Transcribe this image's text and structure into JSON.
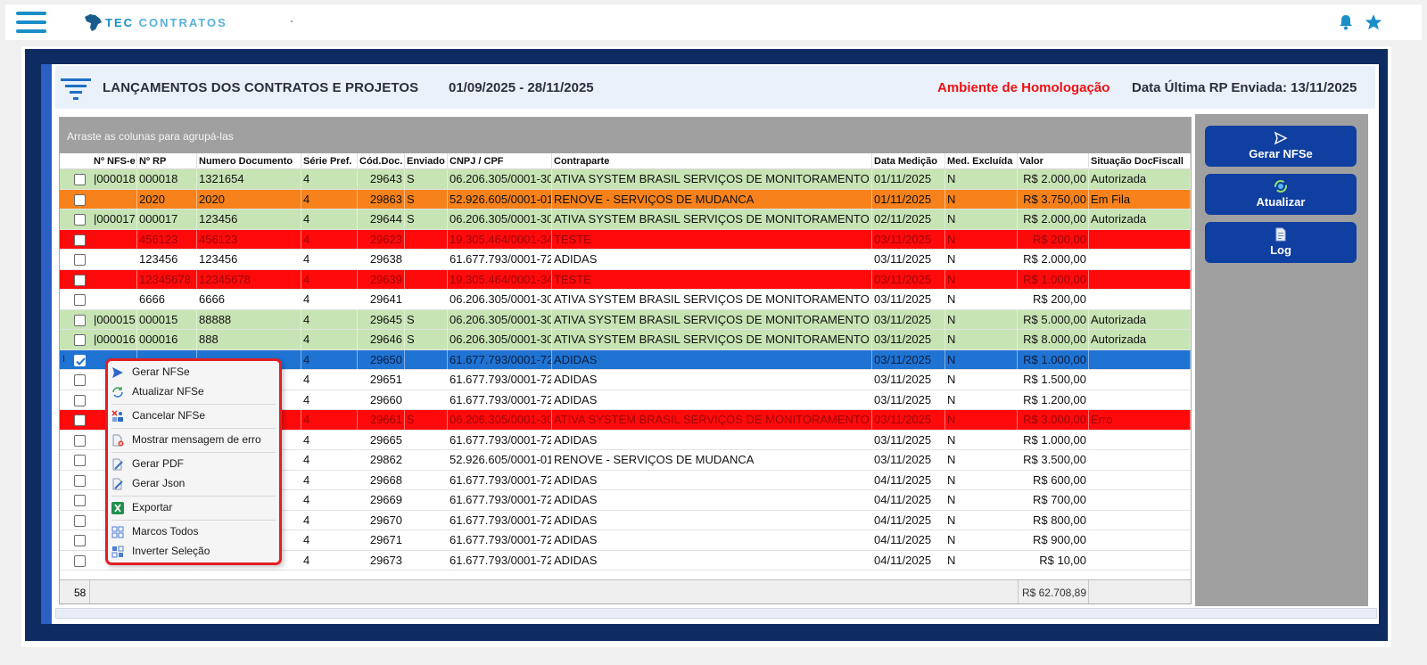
{
  "app": {
    "brand_part1": "TEC",
    "brand_part2": "CONTRATOS"
  },
  "header": {
    "title": "LANÇAMENTOS DOS CONTRATOS E PROJETOS",
    "period": "01/09/2025 - 28/11/2025",
    "environment": "Ambiente de Homologação",
    "last_rp": "Data Última RP Enviada: 13/11/2025",
    "environment_color": "#ee1111"
  },
  "grid": {
    "group_hint": "Arraste as colunas para agrupá-las",
    "columns": [
      "Nº NFS-e",
      "Nº RP",
      "Numero Documento",
      "Série Pref.",
      "Cód.Doc.",
      "Enviado",
      "CNPJ / CPF",
      "Contraparte",
      "Data Medição",
      "Med. Excluída",
      "Valor",
      "Situação DocFiscall"
    ],
    "rows": [
      {
        "style": "green",
        "checked": false,
        "nfse": "|000018",
        "rp": "000018",
        "doc": "1321654",
        "serie": "4",
        "cod": "29643",
        "env": "S",
        "cnpj": "06.206.305/0001-30",
        "contra": "ATIVA SYSTEM BRASIL SERVIÇOS DE MONITORAMENTO LTDA",
        "data": "01/11/2025",
        "excl": "N",
        "valor": "R$ 2.000,00",
        "sit": "Autorizada"
      },
      {
        "style": "orange",
        "checked": false,
        "nfse": "",
        "rp": "2020",
        "doc": "2020",
        "serie": "4",
        "cod": "29863",
        "env": "S",
        "cnpj": "52.926.605/0001-01",
        "contra": "RENOVE - SERVIÇOS DE MUDANCA",
        "data": "01/11/2025",
        "excl": "N",
        "valor": "R$ 3.750,00",
        "sit": "Em Fila"
      },
      {
        "style": "green",
        "checked": false,
        "nfse": "|000017",
        "rp": "000017",
        "doc": "123456",
        "serie": "4",
        "cod": "29644",
        "env": "S",
        "cnpj": "06.206.305/0001-30",
        "contra": "ATIVA SYSTEM BRASIL SERVIÇOS DE MONITORAMENTO LTDA",
        "data": "02/11/2025",
        "excl": "N",
        "valor": "R$ 2.000,00",
        "sit": "Autorizada"
      },
      {
        "style": "red",
        "checked": false,
        "nfse": "",
        "rp": "456123",
        "doc": "456123",
        "serie": "4",
        "cod": "29623",
        "env": "",
        "cnpj": "19.305.464/0001-34",
        "contra": "TESTE",
        "data": "03/11/2025",
        "excl": "N",
        "valor": "R$ 200,00",
        "sit": ""
      },
      {
        "style": "white",
        "checked": false,
        "nfse": "",
        "rp": "123456",
        "doc": "123456",
        "serie": "4",
        "cod": "29638",
        "env": "",
        "cnpj": "61.677.793/0001-72",
        "contra": "ADIDAS",
        "data": "03/11/2025",
        "excl": "N",
        "valor": "R$ 2.000,00",
        "sit": ""
      },
      {
        "style": "red",
        "checked": false,
        "nfse": "",
        "rp": "12345678",
        "doc": "12345678",
        "serie": "4",
        "cod": "29639",
        "env": "",
        "cnpj": "19.305.464/0001-34",
        "contra": "TESTE",
        "data": "03/11/2025",
        "excl": "N",
        "valor": "R$ 1.000,00",
        "sit": ""
      },
      {
        "style": "white",
        "checked": false,
        "nfse": "",
        "rp": "6666",
        "doc": "6666",
        "serie": "4",
        "cod": "29641",
        "env": "",
        "cnpj": "06.206.305/0001-30",
        "contra": "ATIVA SYSTEM BRASIL SERVIÇOS DE MONITORAMENTO LTDA",
        "data": "03/11/2025",
        "excl": "N",
        "valor": "R$ 200,00",
        "sit": ""
      },
      {
        "style": "green",
        "checked": false,
        "nfse": "|000015",
        "rp": "000015",
        "doc": "88888",
        "serie": "4",
        "cod": "29645",
        "env": "S",
        "cnpj": "06.206.305/0001-30",
        "contra": "ATIVA SYSTEM BRASIL SERVIÇOS DE MONITORAMENTO LTDA",
        "data": "03/11/2025",
        "excl": "N",
        "valor": "R$ 5.000,00",
        "sit": "Autorizada"
      },
      {
        "style": "green",
        "checked": false,
        "nfse": "|000016",
        "rp": "000016",
        "doc": "888",
        "serie": "4",
        "cod": "29646",
        "env": "S",
        "cnpj": "06.206.305/0001-30",
        "contra": "ATIVA SYSTEM BRASIL SERVIÇOS DE MONITORAMENTO LTDA",
        "data": "03/11/2025",
        "excl": "N",
        "valor": "R$ 8.000,00",
        "sit": "Autorizada"
      },
      {
        "style": "blue",
        "checked": true,
        "nfse": "",
        "rp": "",
        "doc": "",
        "serie": "4",
        "cod": "29650",
        "env": "",
        "cnpj": "61.677.793/0001-72",
        "contra": "ADIDAS",
        "data": "03/11/2025",
        "excl": "N",
        "valor": "R$ 1.000,00",
        "sit": ""
      },
      {
        "style": "white",
        "checked": false,
        "nfse": "",
        "rp": "",
        "doc": "",
        "serie": "4",
        "cod": "29651",
        "env": "",
        "cnpj": "61.677.793/0001-72",
        "contra": "ADIDAS",
        "data": "03/11/2025",
        "excl": "N",
        "valor": "R$ 1.500,00",
        "sit": ""
      },
      {
        "style": "white",
        "checked": false,
        "nfse": "",
        "rp": "",
        "doc": "",
        "serie": "4",
        "cod": "29660",
        "env": "",
        "cnpj": "61.677.793/0001-72",
        "contra": "ADIDAS",
        "data": "03/11/2025",
        "excl": "N",
        "valor": "R$ 1.200,00",
        "sit": ""
      },
      {
        "style": "red",
        "checked": false,
        "nfse": "",
        "rp": "",
        "doc": "",
        "serie": "4",
        "cod": "29661",
        "env": "S",
        "cnpj": "06.206.305/0001-30",
        "contra": "ATIVA SYSTEM BRASIL SERVIÇOS DE MONITORAMENTO LTDA",
        "data": "03/11/2025",
        "excl": "N",
        "valor": "R$ 3.000,00",
        "sit": "Erro"
      },
      {
        "style": "white",
        "checked": false,
        "nfse": "",
        "rp": "",
        "doc": "",
        "serie": "4",
        "cod": "29665",
        "env": "",
        "cnpj": "61.677.793/0001-72",
        "contra": "ADIDAS",
        "data": "03/11/2025",
        "excl": "N",
        "valor": "R$ 1.000,00",
        "sit": ""
      },
      {
        "style": "white",
        "checked": false,
        "nfse": "",
        "rp": "",
        "doc": "",
        "serie": "4",
        "cod": "29862",
        "env": "",
        "cnpj": "52.926.605/0001-01",
        "contra": "RENOVE - SERVIÇOS DE MUDANCA",
        "data": "03/11/2025",
        "excl": "N",
        "valor": "R$ 3.500,00",
        "sit": ""
      },
      {
        "style": "white",
        "checked": false,
        "nfse": "",
        "rp": "",
        "doc": "",
        "serie": "4",
        "cod": "29668",
        "env": "",
        "cnpj": "61.677.793/0001-72",
        "contra": "ADIDAS",
        "data": "04/11/2025",
        "excl": "N",
        "valor": "R$ 600,00",
        "sit": ""
      },
      {
        "style": "white",
        "checked": false,
        "nfse": "",
        "rp": "",
        "doc": "",
        "serie": "4",
        "cod": "29669",
        "env": "",
        "cnpj": "61.677.793/0001-72",
        "contra": "ADIDAS",
        "data": "04/11/2025",
        "excl": "N",
        "valor": "R$ 700,00",
        "sit": ""
      },
      {
        "style": "white",
        "checked": false,
        "nfse": "",
        "rp": "",
        "doc": "",
        "serie": "4",
        "cod": "29670",
        "env": "",
        "cnpj": "61.677.793/0001-72",
        "contra": "ADIDAS",
        "data": "04/11/2025",
        "excl": "N",
        "valor": "R$ 800,00",
        "sit": ""
      },
      {
        "style": "white",
        "checked": false,
        "nfse": "",
        "rp": "",
        "doc": "",
        "serie": "4",
        "cod": "29671",
        "env": "",
        "cnpj": "61.677.793/0001-72",
        "contra": "ADIDAS",
        "data": "04/11/2025",
        "excl": "N",
        "valor": "R$ 900,00",
        "sit": ""
      },
      {
        "style": "white",
        "checked": false,
        "nfse": "",
        "rp": "",
        "doc": "",
        "serie": "4",
        "cod": "29673",
        "env": "",
        "cnpj": "61.677.793/0001-72",
        "contra": "ADIDAS",
        "data": "04/11/2025",
        "excl": "N",
        "valor": "R$ 10,00",
        "sit": ""
      }
    ],
    "footer_count": "58",
    "footer_total": "R$ 62.708,89"
  },
  "side_buttons": [
    {
      "label": "Gerar NFSe",
      "icon": "send-icon"
    },
    {
      "label": "Atualizar",
      "icon": "refresh-icon"
    },
    {
      "label": "Log",
      "icon": "document-icon"
    }
  ],
  "context_menu": {
    "items": [
      {
        "label": "Gerar NFSe",
        "icon": "send-icon"
      },
      {
        "label": "Atualizar NFSe",
        "icon": "refresh-icon"
      },
      {
        "label": "Cancelar NFSe",
        "icon": "cancel-icon"
      },
      {
        "label": "Mostrar mensagem de erro",
        "icon": "error-document-icon"
      },
      {
        "label": "Gerar PDF",
        "icon": "pdf-icon"
      },
      {
        "label": "Gerar Json",
        "icon": "json-icon"
      },
      {
        "label": "Exportar",
        "icon": "excel-icon"
      },
      {
        "label": "Marcos Todos",
        "icon": "select-all-icon"
      },
      {
        "label": "Inverter Seleção",
        "icon": "invert-selection-icon"
      }
    ]
  }
}
